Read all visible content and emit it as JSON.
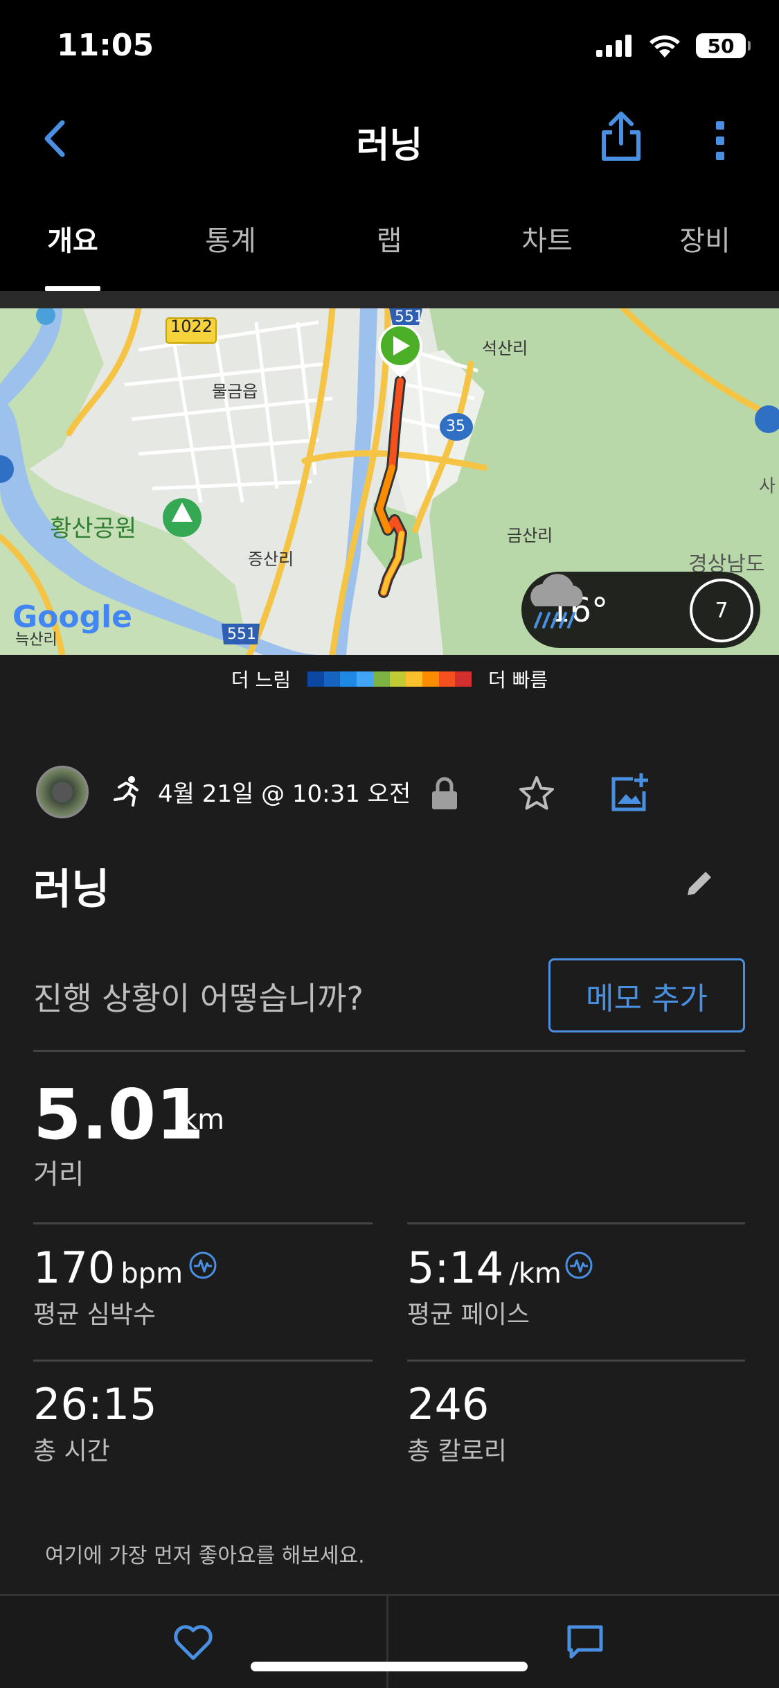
{
  "status_bar": {
    "time": "11:05",
    "battery": "50"
  },
  "header": {
    "title": "러닝"
  },
  "tabs": [
    {
      "label": "개요",
      "active": true
    },
    {
      "label": "통계",
      "active": false
    },
    {
      "label": "랩",
      "active": false
    },
    {
      "label": "차트",
      "active": false
    },
    {
      "label": "장비",
      "active": false
    }
  ],
  "map": {
    "labels": {
      "road_1022": "1022",
      "road_551_top": "551",
      "road_551_bottom": "551",
      "road_35": "35",
      "mulgeum": "물금읍",
      "seoksan": "석산리",
      "hwangsan": "황산공원",
      "jeungsan": "증산리",
      "geumsan": "금산리",
      "gyeongsang": "경상남도",
      "sa": "사",
      "google": "Google",
      "nuksan": "늑산리"
    },
    "weather": {
      "temp": "16°",
      "wind": "7"
    }
  },
  "legend": {
    "slow": "더 느림",
    "fast": "더 빠름",
    "colors": [
      "#0d47a1",
      "#1565c0",
      "#1e88e5",
      "#42a5f5",
      "#7cb342",
      "#c0ca33",
      "#fbc02d",
      "#fb8c00",
      "#f4511e",
      "#d32f2f"
    ]
  },
  "activity": {
    "date": "4월 21일 @ 10:31 오전",
    "title": "러닝",
    "prompt": "진행 상황이 어떻습니까?",
    "memo_button": "메모 추가"
  },
  "stats": {
    "distance": {
      "value": "5.01",
      "unit": "km",
      "label": "거리"
    },
    "avg_hr": {
      "value": "170",
      "unit": "bpm",
      "label": "평균 심박수"
    },
    "avg_pace": {
      "value": "5:14",
      "unit": "/km",
      "label": "평균 페이스"
    },
    "total_time": {
      "value": "26:15",
      "label": "총 시간"
    },
    "calories": {
      "value": "246",
      "label": "총 칼로리"
    }
  },
  "like_prompt": "여기에 가장 먼저 좋아요를 해보세요."
}
